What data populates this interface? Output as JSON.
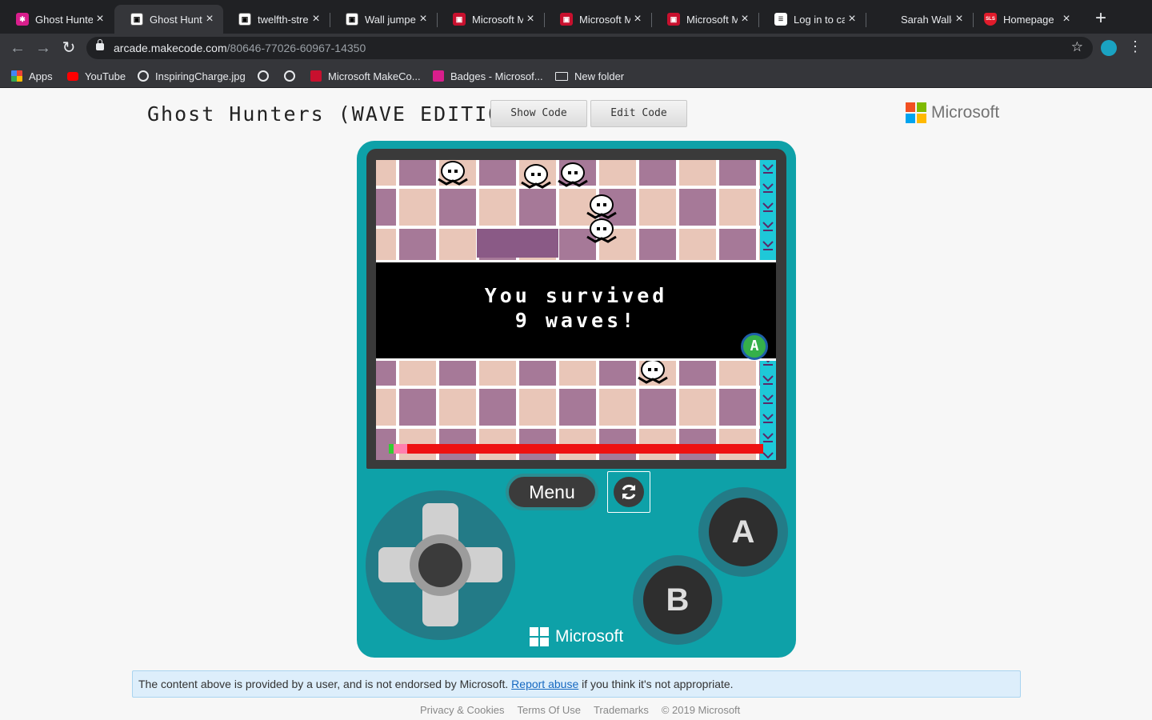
{
  "browser": {
    "tabs": [
      {
        "title": "Ghost Hunte",
        "icon": "makecode-icon",
        "active": false
      },
      {
        "title": "Ghost Hunte",
        "icon": "makecode-icon",
        "active": true
      },
      {
        "title": "twelfth-strea",
        "icon": "makecode-icon",
        "active": false
      },
      {
        "title": "Wall jumper",
        "icon": "makecode-icon",
        "active": false
      },
      {
        "title": "Microsoft Ma",
        "icon": "makecode-red-icon",
        "active": false
      },
      {
        "title": "Microsoft Ma",
        "icon": "makecode-red-icon",
        "active": false
      },
      {
        "title": "Microsoft Ma",
        "icon": "makecode-red-icon",
        "active": false
      },
      {
        "title": "Log in to can",
        "icon": "canvas-icon",
        "active": false
      },
      {
        "title": "Sarah Wallet",
        "icon": "blank-icon",
        "active": false
      },
      {
        "title": "Homepage",
        "icon": "sls-shield-icon",
        "icon_text": "SLS",
        "active": false
      }
    ],
    "url_host": "arcade.makecode.com",
    "url_path": "/80646-77026-60967-14350",
    "bookmarks": [
      {
        "label": "Apps",
        "icon": "apps-grid-icon"
      },
      {
        "label": "YouTube",
        "icon": "youtube-icon"
      },
      {
        "label": "InspiringCharge.jpg",
        "icon": "globe-icon"
      },
      {
        "label": "",
        "icon": "globe-icon"
      },
      {
        "label": "",
        "icon": "globe-icon"
      },
      {
        "label": "Microsoft MakeCo...",
        "icon": "makecode-red-icon"
      },
      {
        "label": "Badges - Microsof...",
        "icon": "makecode-pink-icon"
      },
      {
        "label": "New folder",
        "icon": "folder-icon"
      }
    ]
  },
  "page": {
    "title": "Ghost Hunters (WAVE EDITION)",
    "show_code": "Show Code",
    "edit_code": "Edit Code",
    "brand": "Microsoft"
  },
  "game": {
    "message_line1": "You survived",
    "message_line2": "9 waves!",
    "a_prompt": "A",
    "health_fraction": 0.05
  },
  "controls": {
    "menu": "Menu",
    "a": "A",
    "b": "B",
    "brand": "Microsoft"
  },
  "notice": {
    "before": "The content above is provided by a user, and is not endorsed by Microsoft.",
    "link": "Report abuse",
    "after": "if you think it's not appropriate."
  },
  "footer": {
    "links": [
      "Privacy & Cookies",
      "Terms Of Use",
      "Trademarks"
    ],
    "copyright": "© 2019 Microsoft"
  },
  "colors": {
    "console": "#0ea1a8",
    "tile_light": "#e9c6b8",
    "tile_dark": "#a67998",
    "health_bar": "#ee1111",
    "ms_red": "#f25022",
    "ms_green": "#7fba00",
    "ms_blue": "#00a4ef",
    "ms_yellow": "#ffb900"
  }
}
